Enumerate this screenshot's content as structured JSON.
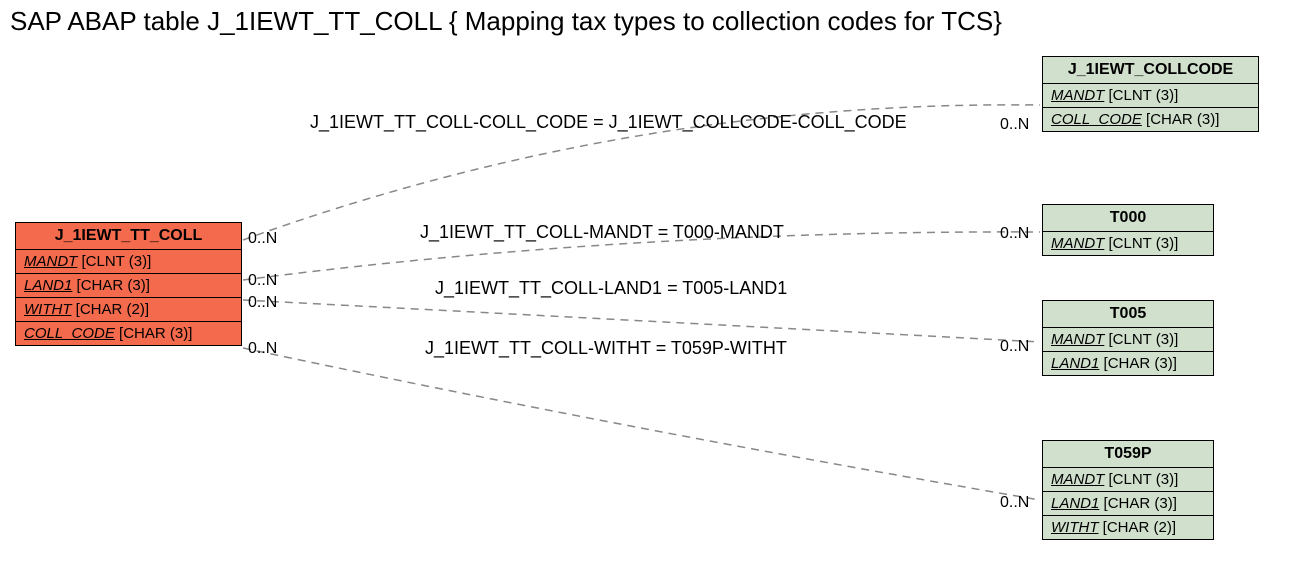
{
  "title": "SAP ABAP table J_1IEWT_TT_COLL { Mapping tax types to collection codes for TCS}",
  "mainTable": {
    "name": "J_1IEWT_TT_COLL",
    "fields": [
      {
        "key": true,
        "name": "MANDT",
        "type": "[CLNT (3)]"
      },
      {
        "key": true,
        "name": "LAND1",
        "type": "[CHAR (3)]"
      },
      {
        "key": true,
        "name": "WITHT",
        "type": "[CHAR (2)]"
      },
      {
        "key": true,
        "name": "COLL_CODE",
        "type": "[CHAR (3)]"
      }
    ]
  },
  "refTables": [
    {
      "name": "J_1IEWT_COLLCODE",
      "fields": [
        {
          "key": true,
          "name": "MANDT",
          "type": "[CLNT (3)]"
        },
        {
          "key": true,
          "name": "COLL_CODE",
          "type": "[CHAR (3)]"
        }
      ]
    },
    {
      "name": "T000",
      "fields": [
        {
          "key": true,
          "name": "MANDT",
          "type": "[CLNT (3)]"
        }
      ]
    },
    {
      "name": "T005",
      "fields": [
        {
          "key": true,
          "name": "MANDT",
          "type": "[CLNT (3)]"
        },
        {
          "key": true,
          "name": "LAND1",
          "type": "[CHAR (3)]"
        }
      ]
    },
    {
      "name": "T059P",
      "fields": [
        {
          "key": true,
          "name": "MANDT",
          "type": "[CLNT (3)]"
        },
        {
          "key": true,
          "name": "LAND1",
          "type": "[CHAR (3)]"
        },
        {
          "key": true,
          "name": "WITHT",
          "type": "[CHAR (2)]"
        }
      ]
    }
  ],
  "relations": [
    {
      "label": "J_1IEWT_TT_COLL-COLL_CODE = J_1IEWT_COLLCODE-COLL_CODE",
      "leftCard": "0..N",
      "rightCard": "0..N"
    },
    {
      "label": "J_1IEWT_TT_COLL-MANDT = T000-MANDT",
      "leftCard": "0..N",
      "rightCard": "0..N"
    },
    {
      "label": "J_1IEWT_TT_COLL-LAND1 = T005-LAND1",
      "leftCard": "0..N",
      "rightCard": "0..N"
    },
    {
      "label": "J_1IEWT_TT_COLL-WITHT = T059P-WITHT",
      "leftCard": "0..N",
      "rightCard": "0..N"
    }
  ],
  "chart_data": {
    "type": "diagram",
    "title": "SAP ABAP table J_1IEWT_TT_COLL { Mapping tax types to collection codes for TCS}",
    "entities": [
      {
        "name": "J_1IEWT_TT_COLL",
        "fields": [
          "MANDT CLNT(3)",
          "LAND1 CHAR(3)",
          "WITHT CHAR(2)",
          "COLL_CODE CHAR(3)"
        ]
      },
      {
        "name": "J_1IEWT_COLLCODE",
        "fields": [
          "MANDT CLNT(3)",
          "COLL_CODE CHAR(3)"
        ]
      },
      {
        "name": "T000",
        "fields": [
          "MANDT CLNT(3)"
        ]
      },
      {
        "name": "T005",
        "fields": [
          "MANDT CLNT(3)",
          "LAND1 CHAR(3)"
        ]
      },
      {
        "name": "T059P",
        "fields": [
          "MANDT CLNT(3)",
          "LAND1 CHAR(3)",
          "WITHT CHAR(2)"
        ]
      }
    ],
    "relationships": [
      {
        "from": "J_1IEWT_TT_COLL",
        "to": "J_1IEWT_COLLCODE",
        "on": "COLL_CODE",
        "cardinality": "0..N — 0..N"
      },
      {
        "from": "J_1IEWT_TT_COLL",
        "to": "T000",
        "on": "MANDT",
        "cardinality": "0..N — 0..N"
      },
      {
        "from": "J_1IEWT_TT_COLL",
        "to": "T005",
        "on": "LAND1",
        "cardinality": "0..N — 0..N"
      },
      {
        "from": "J_1IEWT_TT_COLL",
        "to": "T059P",
        "on": "WITHT",
        "cardinality": "0..N — 0..N"
      }
    ]
  }
}
